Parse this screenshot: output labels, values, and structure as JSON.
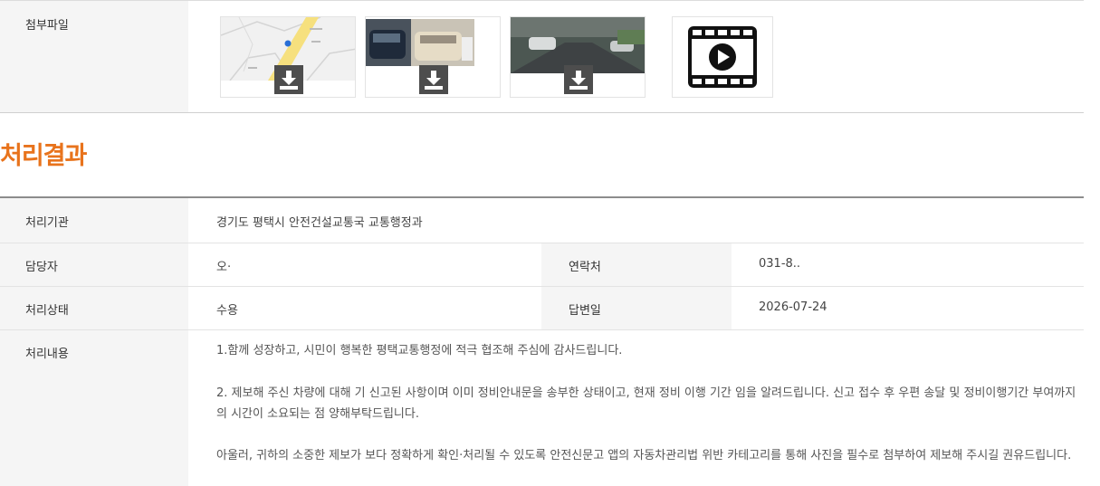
{
  "attachments": {
    "label": "첨부파일",
    "files": [
      {
        "name": "map-image",
        "kind": "image"
      },
      {
        "name": "car-photo",
        "kind": "image"
      },
      {
        "name": "dashcam-photo",
        "kind": "image"
      },
      {
        "name": "video-file",
        "kind": "video"
      }
    ]
  },
  "result": {
    "title": "처리결과",
    "agency_label": "처리기관",
    "agency_value": "경기도 평택시 안전건설교통국 교통행정과",
    "manager_label": "담당자",
    "manager_value": "오·",
    "contact_label": "연락처",
    "contact_value": "031-8..",
    "status_label": "처리상태",
    "status_value": "수용",
    "reply_date_label": "답변일",
    "reply_date_value": "2026-07-24",
    "content_label": "처리내용",
    "content_p1": "1.함께 성장하고, 시민이 행복한 평택교통행정에 적극 협조해 주심에 감사드립니다.",
    "content_p2": "2. 제보해 주신 차량에 대해 기 신고된 사항이며 이미 정비안내문을 송부한 상태이고, 현재 정비 이행 기간 임을 알려드립니다. 신고 접수 후 우편 송달 및 정비이행기간 부여까지의 시간이 소요되는 점 양해부탁드립니다.",
    "content_p3": "아울러, 귀하의 소중한 제보가 보다 정확하게 확인·처리될 수 있도록 안전신문고 앱의 자동차관리법 위반 카테고리를 통해 사진을 필수로 첨부하여 제보해 주시길 권유드립니다."
  },
  "colors": {
    "accent": "#e8731c",
    "label_bg": "#f5f5f5"
  }
}
